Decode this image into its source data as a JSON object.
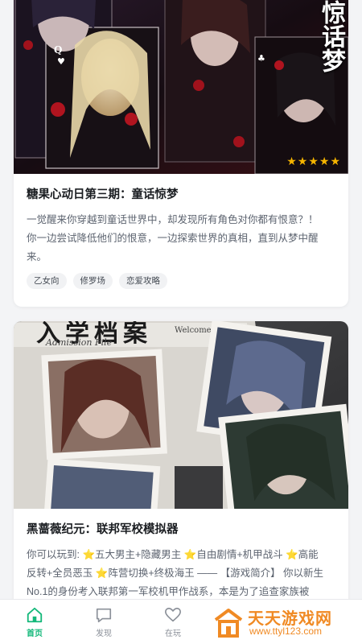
{
  "cards": [
    {
      "cover_title": "惊话梦",
      "rating_stars": 5,
      "title": "糖果心动日第三期：童话惊梦",
      "description_lines": [
        "一觉醒来你穿越到童话世界中，却发现所有角色对你都有恨意？！",
        "你一边尝试降低他们的恨意，一边探索世界的真相，直到从梦中醒",
        "来。"
      ],
      "tags": [
        "乙女向",
        "修罗场",
        "恋爱攻略"
      ]
    },
    {
      "cover_title": "入学档案",
      "cover_subtitle": "Admission File",
      "cover_welcome": "Welcome",
      "title": "黑蔷薇纪元：联邦军校模拟器",
      "description_lines": [
        "你可以玩到: ⭐五大男主+隐藏男主 ⭐自由剧情+机甲战斗 ⭐高能",
        "反转+全员恶玉 ⭐阵营切换+终极海王 —— 【游戏简介】 你以新生",
        "No.1的身份考入联邦第一军校机甲作战系，本是为了追查家族被"
      ]
    }
  ],
  "tabbar": {
    "items": [
      {
        "label": "首页",
        "icon": "home-icon",
        "active": true
      },
      {
        "label": "发现",
        "icon": "message-icon",
        "active": false
      },
      {
        "label": "在玩",
        "icon": "heart-icon",
        "active": false
      }
    ]
  },
  "watermark": {
    "main": "天天游戏网",
    "sub": "www.ttyl123.com"
  },
  "colors": {
    "accent": "#14b87a",
    "star": "#f5b400",
    "watermark": "#f08a24"
  }
}
